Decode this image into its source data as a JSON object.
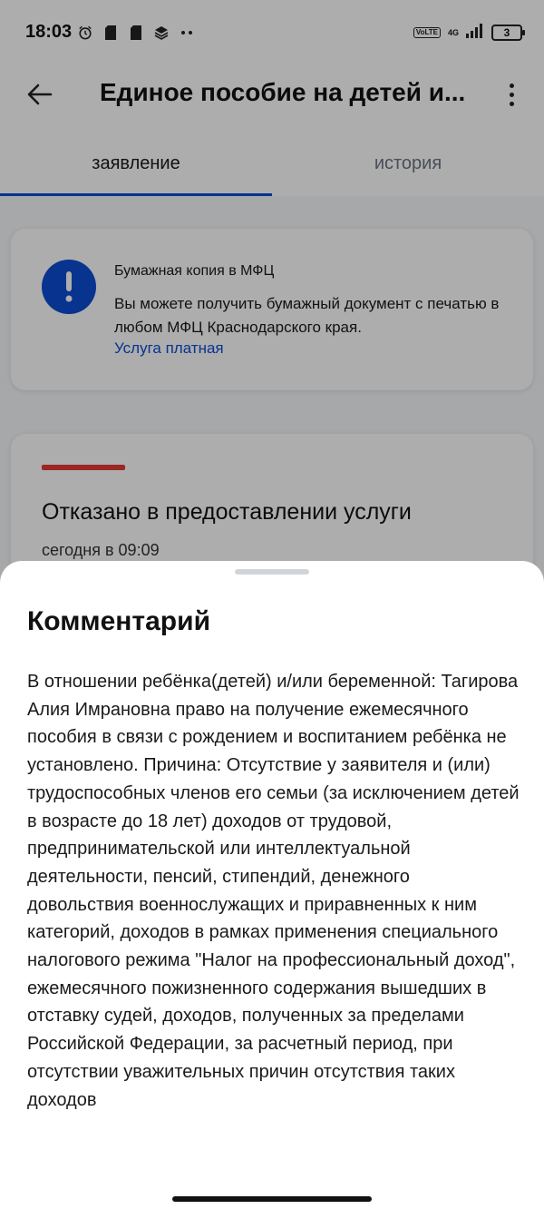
{
  "status_bar": {
    "time": "18:03",
    "network": "4G",
    "volte": "VoLTE",
    "battery": "3"
  },
  "app_bar": {
    "title": "Единое пособие на детей и...",
    "back_icon": "arrow-left-icon",
    "more_icon": "more-vertical-icon"
  },
  "tabs": [
    {
      "label": "заявление",
      "active": true
    },
    {
      "label": "история",
      "active": false
    }
  ],
  "notice": {
    "icon": "exclamation-icon",
    "title": "Бумажная копия в МФЦ",
    "text": "Вы можете получить бумажный документ с печатью в любом МФЦ Краснодарского края.",
    "link": "Услуга платная"
  },
  "status": {
    "title": "Отказано в предоставлении услуги",
    "time": "сегодня в 09:09"
  },
  "sheet": {
    "title": "Комментарий",
    "body": "В отношении ребёнка(детей) и/или беременной: Тагирова Алия Имрановна право на получение ежемесячного пособия в связи с рождением и воспитанием ребёнка не установлено. Причина: Отсутствие у заявителя и (или) трудоспособных членов его семьи (за исключением детей в возрасте до 18 лет) доходов от трудовой, предпринимательской или интеллектуальной деятельности, пенсий, стипендий, денежного довольствия военнослужащих и приравненных к ним категорий, доходов в рамках применения специального налогового режима \"Налог на профессиональный доход\", ежемесячного пожизненного содержания вышедших в отставку судей, доходов, полученных за пределами Российской Федерации, за расчетный период, при отсутствии уважительных причин отсутствия таких доходов"
  },
  "colors": {
    "accent": "#0d4cd3",
    "status_red": "#e53935"
  }
}
